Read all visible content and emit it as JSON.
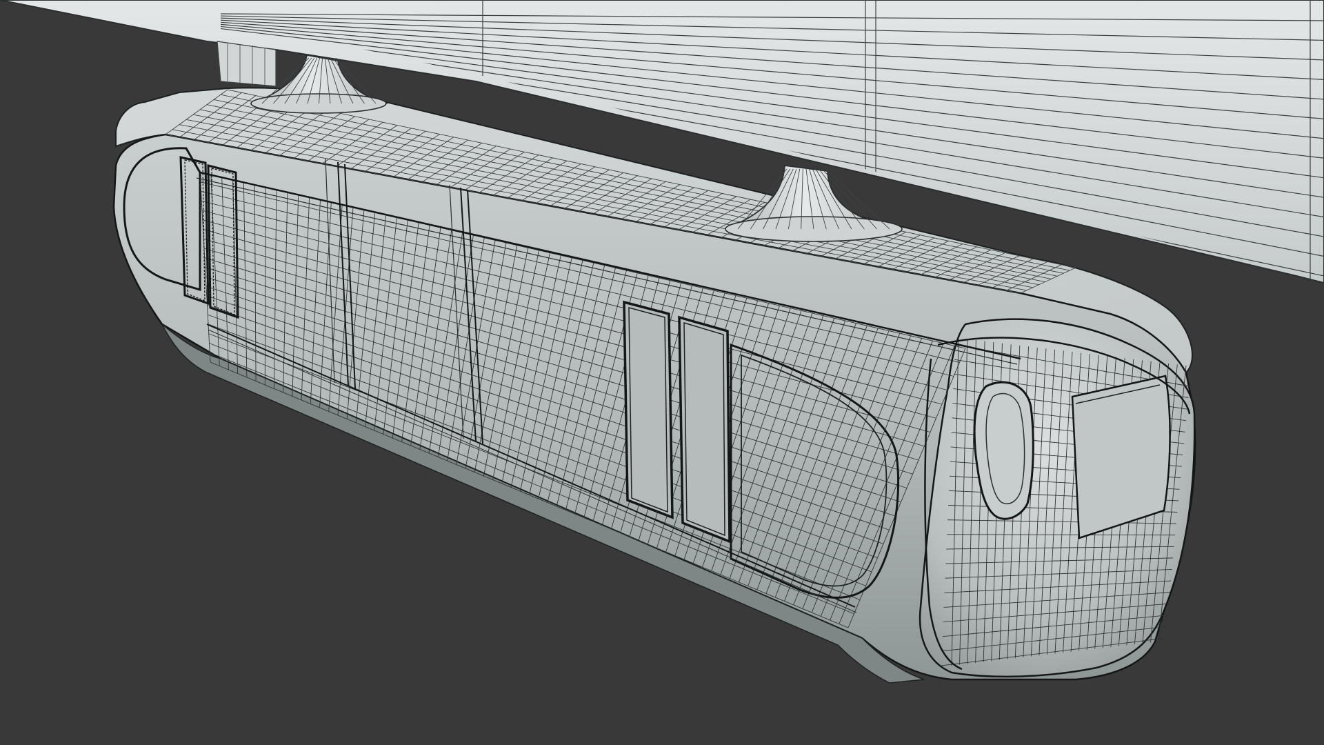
{
  "scene": {
    "subject": "suspended-monorail-car-wireframe-render",
    "colors": {
      "background": "#393939",
      "surface_light": "#d8dcdc",
      "surface_mid": "#b8bebe",
      "surface_dark": "#8e9595",
      "wire": "#2a2e2e",
      "edge": "#151717"
    }
  }
}
